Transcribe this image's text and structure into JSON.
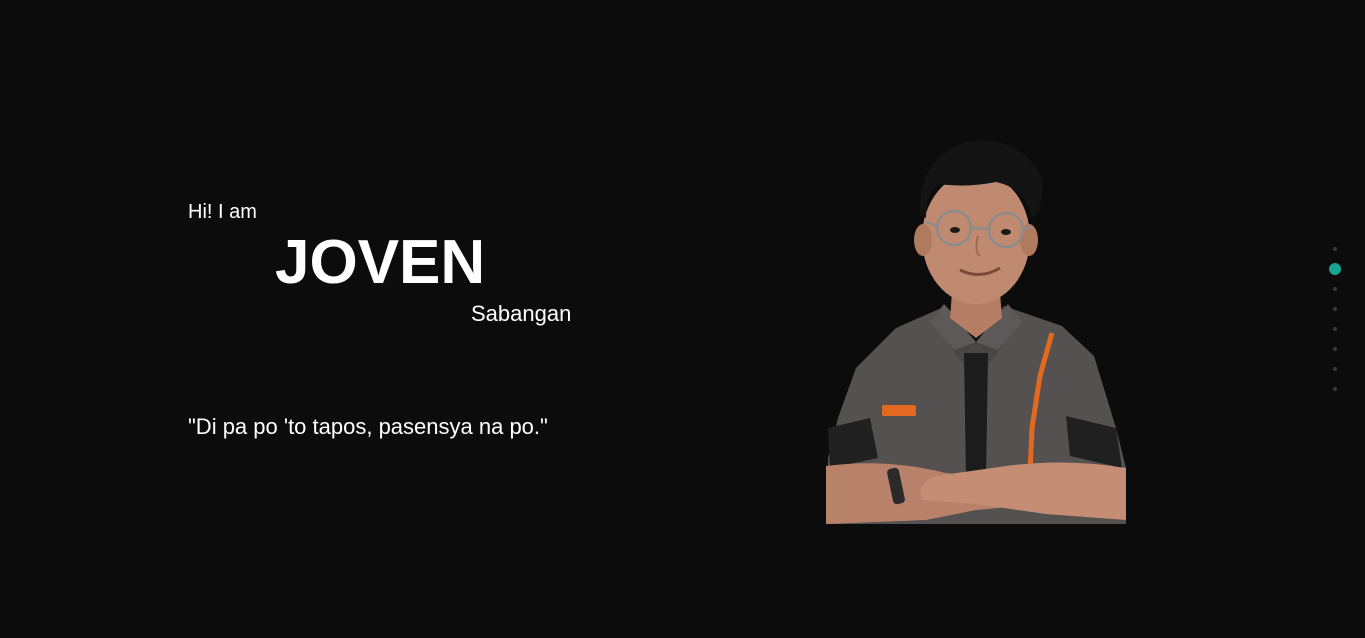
{
  "hero": {
    "greeting": "Hi! I am",
    "first_name": "JOVEN",
    "last_name": "Sabangan",
    "quote": "\"Di pa po 'to tapos, pasensya na po.\""
  },
  "dot_nav": {
    "count": 8,
    "active_index": 1,
    "active_color": "#1aa391",
    "inactive_color": "#3a3a3a"
  },
  "colors": {
    "background": "#0c0c0c",
    "text": "#ffffff",
    "accent": "#1aa391"
  }
}
